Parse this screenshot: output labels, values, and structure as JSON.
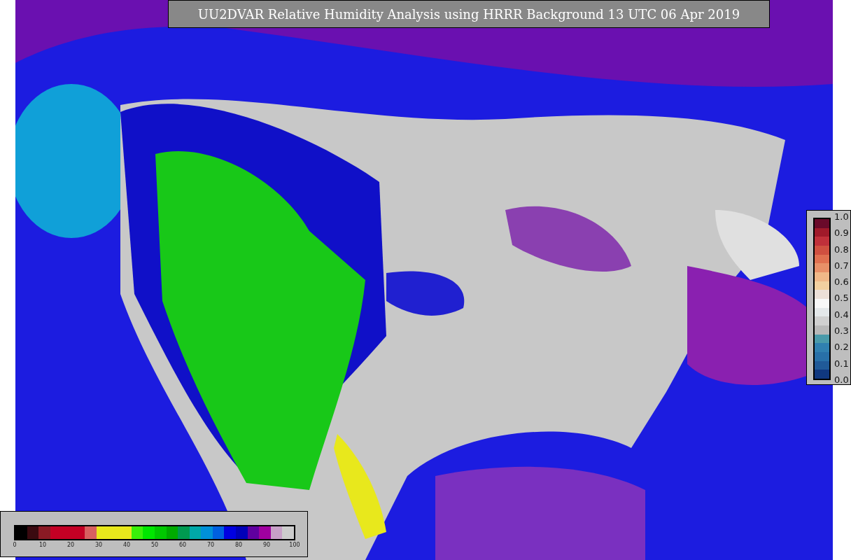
{
  "title": "UU2DVAR Relative Humidity Analysis using HRRR Background 13 UTC 06 Apr 2019",
  "humidity_colorbar": {
    "ticks": [
      "0",
      "10",
      "20",
      "30",
      "40",
      "50",
      "60",
      "70",
      "80",
      "90",
      "100"
    ]
  },
  "innovation_colorbar": {
    "ticks": [
      "1.0",
      "0.9",
      "0.8",
      "0.7",
      "0.6",
      "0.5",
      "0.4",
      "0.3",
      "0.2",
      "0.1",
      "0.0"
    ]
  }
}
